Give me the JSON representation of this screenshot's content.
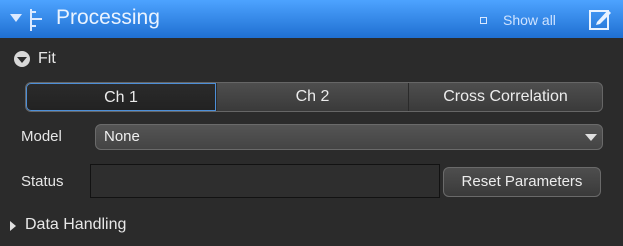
{
  "header": {
    "title": "Processing",
    "show_all_label": "Show all"
  },
  "fit": {
    "label": "Fit"
  },
  "tabs": [
    {
      "label": "Ch 1",
      "selected": true
    },
    {
      "label": "Ch 2",
      "selected": false
    },
    {
      "label": "Cross Correlation",
      "selected": false
    }
  ],
  "model": {
    "label": "Model",
    "value": "None"
  },
  "status": {
    "label": "Status",
    "value": "",
    "reset_label": "Reset Parameters"
  },
  "data_handling": {
    "label": "Data Handling"
  },
  "colors": {
    "header_top": "#4da3ff",
    "header_bottom": "#1f6fd1",
    "panel_bg": "#2b2b2b",
    "selected_tab_border": "#4d8fd8"
  },
  "icons": {
    "header_collapse": "triangle-down-icon",
    "header_tree": "tree-icon",
    "header_edit": "edit-icon",
    "fit_collapse": "chevron-circle-down-icon",
    "model_dropdown": "chevron-down-icon",
    "data_handling_expand": "triangle-right-icon"
  }
}
